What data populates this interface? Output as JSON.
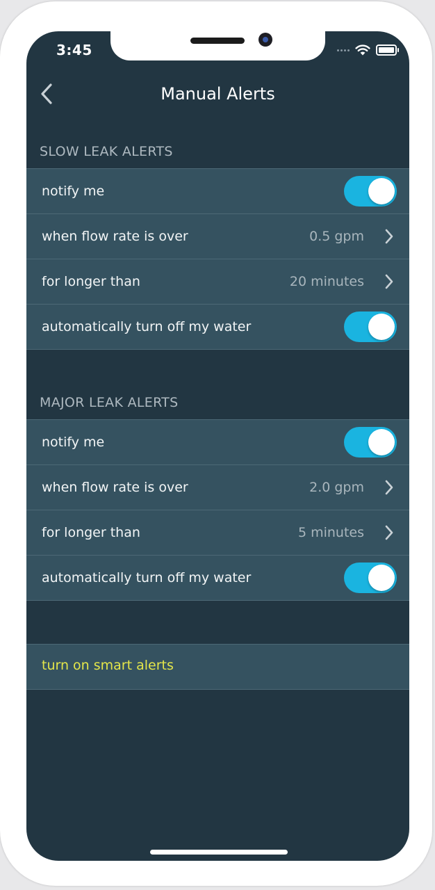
{
  "status_bar": {
    "time": "3:45",
    "icons": [
      "signal-dots-icon",
      "wifi-icon",
      "battery-icon"
    ]
  },
  "nav": {
    "title": "Manual Alerts",
    "back_icon": "chevron-left-icon"
  },
  "slow_leak": {
    "header": "SLOW LEAK ALERTS",
    "notify_label": "notify me",
    "notify_on": true,
    "flow_label": "when flow rate is over",
    "flow_value": "0.5 gpm",
    "duration_label": "for longer than",
    "duration_value": "20 minutes",
    "shutoff_label": "automatically turn off my water",
    "shutoff_on": true
  },
  "major_leak": {
    "header": "MAJOR LEAK ALERTS",
    "notify_label": "notify me",
    "notify_on": true,
    "flow_label": "when flow rate is over",
    "flow_value": "2.0 gpm",
    "duration_label": "for longer than",
    "duration_value": "5 minutes",
    "shutoff_label": "automatically turn off my water",
    "shutoff_on": true
  },
  "smart_alerts": {
    "label": "turn on smart alerts"
  },
  "colors": {
    "background": "#223642",
    "row": "#355260",
    "toggle_on": "#1ab4e0",
    "accent_link": "#e4e64a"
  }
}
